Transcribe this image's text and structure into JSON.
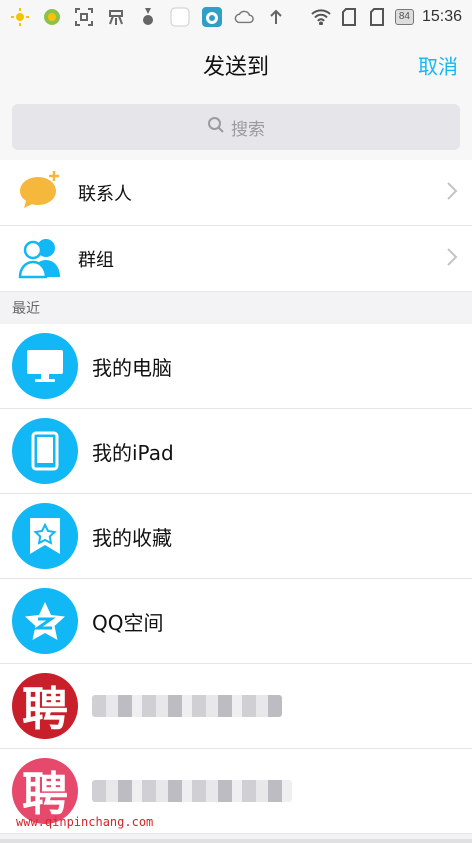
{
  "status": {
    "battery": "84",
    "time": "15:36"
  },
  "header": {
    "title": "发送到",
    "cancel": "取消"
  },
  "search": {
    "placeholder": "搜索"
  },
  "top_rows": [
    {
      "label": "联系人"
    },
    {
      "label": "群组"
    }
  ],
  "section": {
    "recent": "最近"
  },
  "recent": [
    {
      "label": "我的电脑"
    },
    {
      "label": "我的iPad"
    },
    {
      "label": "我的收藏"
    },
    {
      "label": "QQ空间"
    },
    {
      "avatar_char": "聘"
    },
    {
      "avatar_char": "聘"
    }
  ],
  "watermark": "www.qinpinchang.com",
  "colors": {
    "accent": "#12b7f5",
    "contact_yellow": "#f5b83d"
  }
}
